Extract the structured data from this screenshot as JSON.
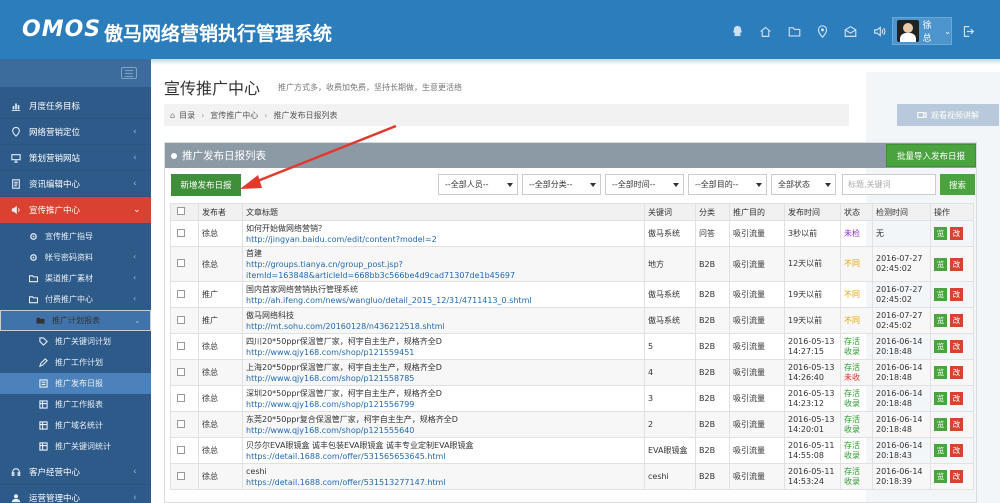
{
  "header": {
    "logo": "OMOS",
    "system_title": "傲马网络营销执行管理系统",
    "user_name": "徐总"
  },
  "header_icons": [
    "qq-icon",
    "home-icon",
    "folder-icon",
    "location-icon",
    "mail-icon",
    "speaker-icon",
    "monitor-icon"
  ],
  "sidebar": {
    "items": [
      {
        "label": "月度任务目标",
        "icon": "chart-icon"
      },
      {
        "label": "网络营销定位",
        "icon": "location-icon",
        "arrow": "‹"
      },
      {
        "label": "策划营销网站",
        "icon": "monitor-icon",
        "arrow": "‹"
      },
      {
        "label": "资讯编辑中心",
        "icon": "document-icon",
        "arrow": "‹"
      },
      {
        "label": "宣传推广中心",
        "icon": "speaker-icon",
        "arrow": "⌄",
        "active": true
      }
    ],
    "subitems": [
      {
        "label": "宣传推广指导",
        "icon": "cog-icon"
      },
      {
        "label": "帐号密码资料",
        "icon": "cog-icon",
        "arrow": "‹"
      },
      {
        "label": "渠道推广素材",
        "icon": "folder-icon",
        "arrow": "‹"
      },
      {
        "label": "付费推广中心",
        "icon": "folder-icon",
        "arrow": "‹"
      },
      {
        "label": "推广计划报表",
        "icon": "folder-icon",
        "arrow": "⌄"
      }
    ],
    "deepitems": [
      {
        "label": "推广关键词计划",
        "icon": "tag-icon"
      },
      {
        "label": "推广工作计划",
        "icon": "pencil-icon"
      },
      {
        "label": "推广发布日报",
        "icon": "list-icon",
        "current": true
      },
      {
        "label": "推广工作报表",
        "icon": "table-icon"
      },
      {
        "label": "推广域名统计",
        "icon": "table-icon"
      },
      {
        "label": "推广关键词统计",
        "icon": "table-icon"
      }
    ],
    "bottom": [
      {
        "label": "客户经营中心",
        "icon": "headset-icon",
        "arrow": "‹"
      },
      {
        "label": "运营管理中心",
        "icon": "user-icon",
        "arrow": "‹"
      }
    ]
  },
  "page": {
    "title": "宣传推广中心",
    "subtitle": "推广方式多，收费加免费，坚持长期做，生意更活络"
  },
  "breadcrumb": [
    "目录",
    "宣传推广中心",
    "推广发布日报列表"
  ],
  "video_button": "观看视频讲解",
  "panel": {
    "title": "推广发布日报列表",
    "bulk_button": "批量导入发布日报",
    "add_button": "新增发布日报",
    "search_button": "搜索",
    "keyword_placeholder": "标题,关键词"
  },
  "filters": [
    "--全部人员--",
    "--全部分类--",
    "--全部时间--",
    "--全部目的--",
    "全部状态"
  ],
  "columns": [
    "",
    "发布者",
    "文章标题",
    "关键词",
    "分类",
    "推广目的",
    "发布时间",
    "状态",
    "检测时间",
    "操作"
  ],
  "rows": [
    {
      "publisher": "徐总",
      "title": "如何开始做网络营销？",
      "url": "http://jingyan.baidu.com/edit/content?model=2",
      "keyword": "傲马系统",
      "category": "问答",
      "purpose": "吸引流量",
      "time": "3秒以前",
      "status": "未检",
      "status_color": "#8b2fc9",
      "check": "无"
    },
    {
      "publisher": "徐总",
      "title": "首建",
      "url": "http://groups.tianya.cn/group_post.jsp?",
      "url2": "itemId=163848&articleId=668bb3c566be4d9cad71307de1b45697",
      "keyword": "地方",
      "category": "B2B",
      "purpose": "吸引流量",
      "time": "12天以前",
      "status": "不同",
      "status_color": "#e8a100",
      "check": "2016-07-27",
      "check2": "02:45:02"
    },
    {
      "publisher": "推广",
      "title": "国内首家网络营销执行管理系统",
      "url": "http://ah.ifeng.com/news/wangluo/detail_2015_12/31/4711413_0.shtml",
      "keyword": "傲马系统",
      "category": "B2B",
      "purpose": "吸引流量",
      "time": "19天以前",
      "status": "不同",
      "status_color": "#e8a100",
      "check": "2016-07-27",
      "check2": "02:45:02"
    },
    {
      "publisher": "推广",
      "title": "傲马网络科技",
      "url": "http://mt.sohu.com/20160128/n436212518.shtml",
      "keyword": "傲马系统",
      "category": "B2B",
      "purpose": "吸引流量",
      "time": "19天以前",
      "status": "不同",
      "status_color": "#e8a100",
      "check": "2016-07-27",
      "check2": "02:45:02"
    },
    {
      "publisher": "徐总",
      "title": "四川20*50ppr保温管厂家，柯宇自主生产，规格齐全D",
      "url": "http://www.qjy168.com/shop/p121559451",
      "keyword": "5",
      "category": "B2B",
      "purpose": "吸引流量",
      "time": "2016-05-13",
      "time2": "14:27:15",
      "status": "存活",
      "status2": "收录",
      "status_color": "#2e9a2e",
      "status2_color": "#2e9a2e",
      "check": "2016-06-14",
      "check2": "20:18:48"
    },
    {
      "publisher": "徐总",
      "title": "上海20*50ppr保温管厂家，柯宇自主生产，规格齐全D",
      "url": "http://www.qjy168.com/shop/p121558785",
      "keyword": "4",
      "category": "B2B",
      "purpose": "吸引流量",
      "time": "2016-05-13",
      "time2": "14:26:40",
      "status": "存活",
      "status2": "未收",
      "status_color": "#2e9a2e",
      "status2_color": "#d93025",
      "check": "2016-06-14",
      "check2": "20:18:48"
    },
    {
      "publisher": "徐总",
      "title": "深圳20*50ppr保温管厂家，柯宇自主生产，规格齐全D",
      "url": "http://www.qjy168.com/shop/p121556799",
      "keyword": "3",
      "category": "B2B",
      "purpose": "吸引流量",
      "time": "2016-05-13",
      "time2": "14:23:12",
      "status": "存活",
      "status2": "收录",
      "status_color": "#2e9a2e",
      "status2_color": "#2e9a2e",
      "check": "2016-06-14",
      "check2": "20:18:48"
    },
    {
      "publisher": "徐总",
      "title": "东莞20*50ppr复合保温管厂家，柯宇自主生产，规格齐全D",
      "url": "http://www.qjy168.com/shop/p121555640",
      "keyword": "2",
      "category": "B2B",
      "purpose": "吸引流量",
      "time": "2016-05-13",
      "time2": "14:20:01",
      "status": "存活",
      "status2": "收录",
      "status_color": "#2e9a2e",
      "status2_color": "#2e9a2e",
      "check": "2016-06-14",
      "check2": "20:18:48"
    },
    {
      "publisher": "徐总",
      "title": "贝莎尔EVA眼镜盒 诚丰包装EVA眼镜盒 诚丰专业定制EVA眼镜盒",
      "url": "https://detail.1688.com/offer/531565653645.html",
      "keyword": "EVA眼镜盒",
      "category": "B2B",
      "purpose": "吸引流量",
      "time": "2016-05-11",
      "time2": "14:55:08",
      "status": "存活",
      "status2": "收录",
      "status_color": "#2e9a2e",
      "status2_color": "#2e9a2e",
      "check": "2016-06-14",
      "check2": "20:18:43"
    },
    {
      "publisher": "徐总",
      "title": "ceshi",
      "url": "https://detail.1688.com/offer/531513277147.html",
      "keyword": "ceshi",
      "category": "B2B",
      "purpose": "吸引流量",
      "time": "2016-05-11",
      "time2": "14:53:24",
      "status": "存活",
      "status2": "收录",
      "status_color": "#2e9a2e",
      "status2_color": "#2e9a2e",
      "check": "2016-06-14",
      "check2": "20:18:39"
    }
  ],
  "row_actions": {
    "view": "览",
    "edit": "改"
  }
}
